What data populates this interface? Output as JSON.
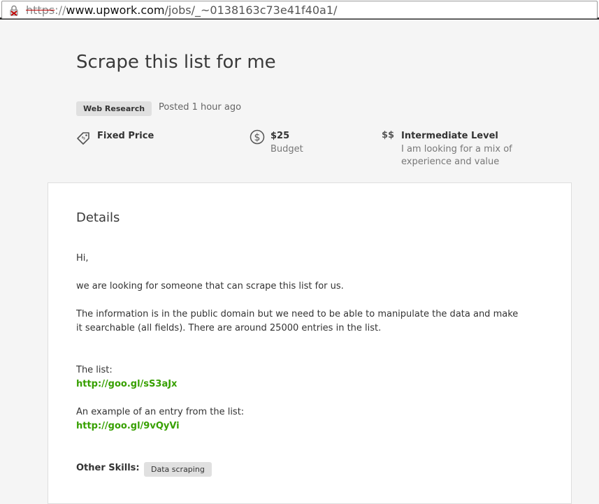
{
  "browser": {
    "url_scheme": "https",
    "url_scheme_rest": "://",
    "url_host": "www.upwork.com",
    "url_path": "/jobs/_~0138163c73e41f40a1/"
  },
  "job": {
    "title": "Scrape this list for me",
    "category": "Web Research",
    "posted": "Posted 1 hour ago",
    "price_type": "Fixed Price",
    "budget_value": "$25",
    "budget_label": "Budget",
    "level_icon": "$$",
    "level_title": "Intermediate Level",
    "level_desc_1": "I am looking for a mix of",
    "level_desc_2": "experience and value"
  },
  "details": {
    "heading": "Details",
    "greeting": "Hi,",
    "line1": "we are looking for someone that can scrape this list for us.",
    "line2a": "The information is in the public domain but we need to be able to manipulate the data and make",
    "line2b": "it searchable (all fields). There are around 25000 entries in the list.",
    "list_label": "The list:",
    "list_link": "http://goo.gl/sS3aJx",
    "example_label": "An example of an entry from the list:",
    "example_link": "http://goo.gl/9vQyVi",
    "other_skills_label": "Other Skills:",
    "skills": [
      "Data scraping"
    ]
  },
  "icons": {
    "price_tag": "price-tag-icon",
    "dollar_circle": "dollar-circle-icon",
    "lock_warning": "broken-lock-icon"
  },
  "colors": {
    "link": "#37a000",
    "tag_bg": "#e0e0e0"
  }
}
